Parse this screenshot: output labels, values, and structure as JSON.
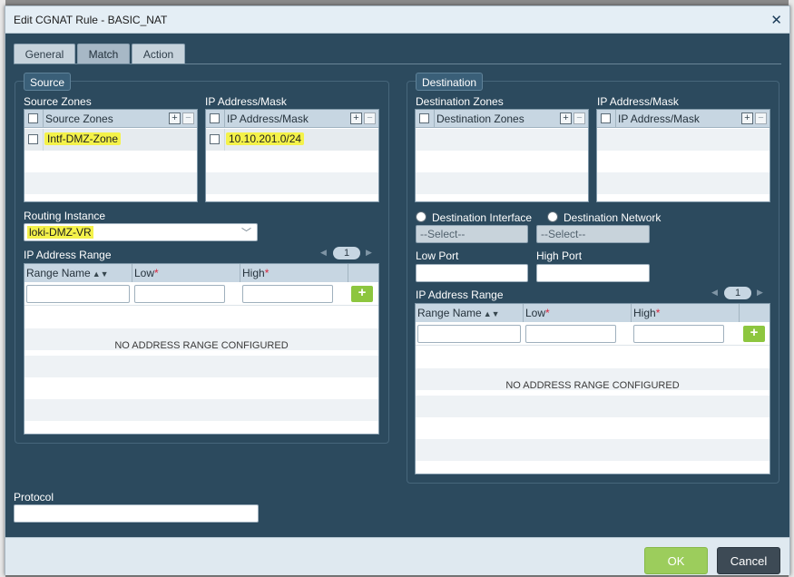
{
  "dialog": {
    "title": "Edit CGNAT Rule - BASIC_NAT",
    "close_glyph": "✕"
  },
  "tabs": [
    {
      "label": "General",
      "active": false
    },
    {
      "label": "Match",
      "active": true
    },
    {
      "label": "Action",
      "active": false
    }
  ],
  "source": {
    "legend": "Source",
    "zones_label": "Source Zones",
    "zones_grid": {
      "header": "Source Zones",
      "rows": [
        "Intf-DMZ-Zone"
      ]
    },
    "ip_label": "IP Address/Mask",
    "ip_grid": {
      "header": "IP Address/Mask",
      "rows": [
        "10.10.201.0/24"
      ]
    },
    "routing_label": "Routing Instance",
    "routing_value": "loki-DMZ-VR",
    "range_label": "IP Address Range",
    "range_page": "1",
    "range_cols": {
      "name": "Range Name",
      "low": "Low",
      "high": "High"
    },
    "range_empty": "NO ADDRESS RANGE CONFIGURED"
  },
  "destination": {
    "legend": "Destination",
    "zones_label": "Destination Zones",
    "zones_grid": {
      "header": "Destination Zones"
    },
    "ip_label": "IP Address/Mask",
    "ip_grid": {
      "header": "IP Address/Mask"
    },
    "radio_interface": "Destination Interface",
    "radio_network": "Destination Network",
    "select_placeholder": "--Select--",
    "low_port_label": "Low Port",
    "high_port_label": "High Port",
    "range_label": "IP Address Range",
    "range_page": "1",
    "range_cols": {
      "name": "Range Name",
      "low": "Low",
      "high": "High"
    },
    "range_empty": "NO ADDRESS RANGE CONFIGURED"
  },
  "protocol": {
    "label": "Protocol"
  },
  "buttons": {
    "ok": "OK",
    "cancel": "Cancel"
  },
  "glyphs": {
    "plus": "+",
    "minus": "−",
    "required": "*",
    "sort": "▲▼",
    "chev": "﹀",
    "left": "◀",
    "right": "▶"
  },
  "colors": {
    "highlight": "#f4f24a",
    "ok": "#9ccd5c",
    "cancel": "#3d4a55",
    "panel": "#2c4a5e"
  }
}
